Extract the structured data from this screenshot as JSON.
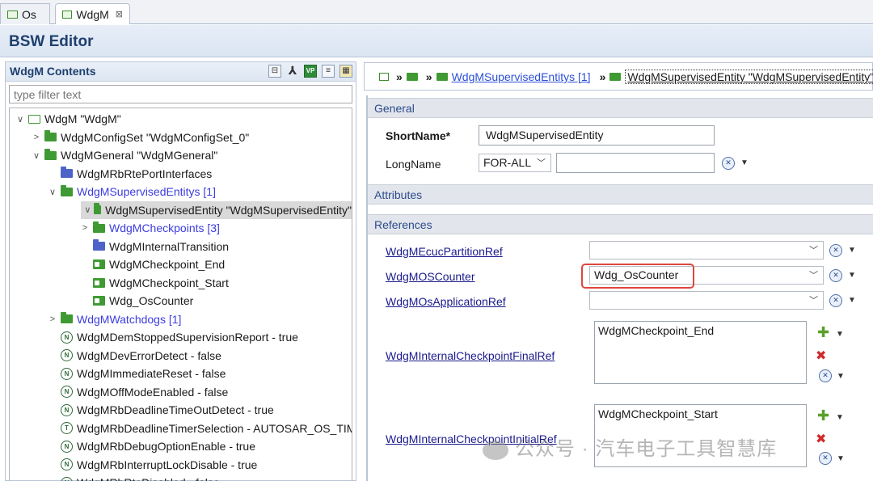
{
  "tabs": [
    {
      "label": "Os",
      "active": false
    },
    {
      "label": "WdgM",
      "active": true,
      "close": "⊠"
    }
  ],
  "editor_title": "BSW Editor",
  "left": {
    "title": "WdgM Contents",
    "filter_placeholder": "type filter text",
    "tree": [
      {
        "label": "WdgM \"WdgM\"",
        "twisty": "∨",
        "icon": "outline",
        "depth": 0
      },
      {
        "label": "WdgMConfigSet \"WdgMConfigSet_0\"",
        "twisty": ">",
        "icon": "folder",
        "depth": 1
      },
      {
        "label": "WdgMGeneral \"WdgMGeneral\"",
        "twisty": "∨",
        "icon": "folder",
        "depth": 1
      },
      {
        "label": "WdgMRbRtePortInterfaces",
        "twisty": "",
        "icon": "blue",
        "depth": 2
      },
      {
        "label": "WdgMSupervisedEntitys [1]",
        "twisty": "∨",
        "icon": "folder",
        "depth": 2,
        "link": true
      },
      {
        "label": "WdgMSupervisedEntity \"WdgMSupervisedEntity\"",
        "twisty": "∨",
        "icon": "folder",
        "depth": 3,
        "selected": true
      },
      {
        "label": "WdgMCheckpoints [3]",
        "twisty": ">",
        "icon": "folder",
        "depth": 4,
        "link": true
      },
      {
        "label": "WdgMInternalTransition",
        "twisty": "",
        "icon": "blue",
        "depth": 4
      },
      {
        "label": "WdgMCheckpoint_End",
        "twisty": "",
        "icon": "ref",
        "depth": 4
      },
      {
        "label": "WdgMCheckpoint_Start",
        "twisty": "",
        "icon": "ref",
        "depth": 4
      },
      {
        "label": "Wdg_OsCounter",
        "twisty": "",
        "icon": "ref",
        "depth": 4
      },
      {
        "label": "WdgMWatchdogs [1]",
        "twisty": ">",
        "icon": "folder",
        "depth": 2,
        "link": true
      },
      {
        "label": "WdgMDemStoppedSupervisionReport - true",
        "twisty": "",
        "icon": "param",
        "depth": 2
      },
      {
        "label": "WdgMDevErrorDetect - false",
        "twisty": "",
        "icon": "param",
        "depth": 2
      },
      {
        "label": "WdgMImmediateReset - false",
        "twisty": "",
        "icon": "param",
        "depth": 2
      },
      {
        "label": "WdgMOffModeEnabled - false",
        "twisty": "",
        "icon": "param",
        "depth": 2
      },
      {
        "label": "WdgMRbDeadlineTimeOutDetect - true",
        "twisty": "",
        "icon": "param",
        "depth": 2
      },
      {
        "label": "WdgMRbDeadlineTimerSelection - AUTOSAR_OS_TIM",
        "twisty": "",
        "icon": "param-t",
        "depth": 2
      },
      {
        "label": "WdgMRbDebugOptionEnable - true",
        "twisty": "",
        "icon": "param",
        "depth": 2
      },
      {
        "label": "WdgMRbInterruptLockDisable - true",
        "twisty": "",
        "icon": "param",
        "depth": 2
      },
      {
        "label": "WdgMRbRteDisabled - false",
        "twisty": "",
        "icon": "param",
        "depth": 2
      }
    ]
  },
  "breadcrumb": {
    "link": "WdgMSupervisedEntitys [1]",
    "current": "WdgMSupervisedEntity \"WdgMSupervisedEntity\""
  },
  "sections": {
    "general": "General",
    "attributes": "Attributes",
    "references": "References"
  },
  "general": {
    "shortname_label": "ShortName*",
    "shortname_value": "WdgMSupervisedEntity",
    "longname_label": "LongName",
    "lang_value": "FOR-ALL",
    "longname_value": ""
  },
  "references": {
    "ecuc_label": "WdgMEcucPartitionRef",
    "ecuc_value": "",
    "oscounter_label": "WdgMOSCounter",
    "oscounter_value": "Wdg_OsCounter",
    "osapp_label": "WdgMOsApplicationRef",
    "osapp_value": "",
    "final_label": "WdgMInternalCheckpointFinalRef",
    "final_items": [
      "WdgMCheckpoint_End"
    ],
    "initial_label": "WdgMInternalCheckpointInitialRef",
    "initial_items": [
      "WdgMCheckpoint_Start"
    ]
  },
  "watermark": "公众号 · 汽车电子工具智慧库"
}
